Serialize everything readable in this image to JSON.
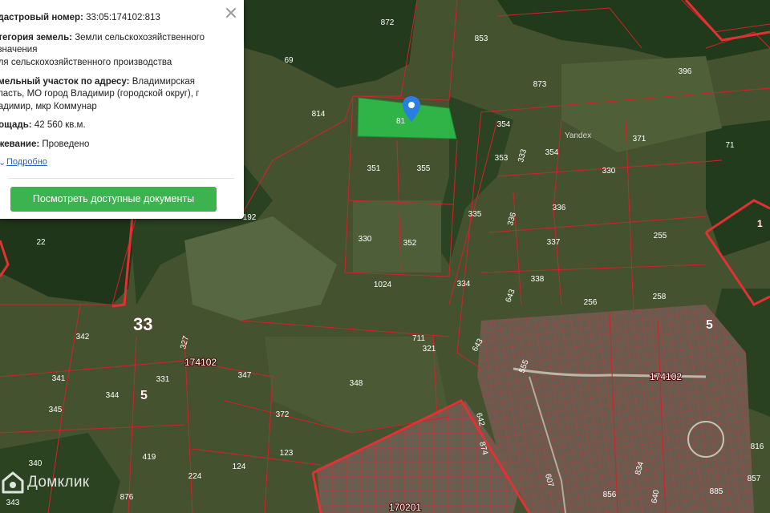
{
  "popup": {
    "cadastral_label": "адастровый номер:",
    "cadastral_value": "33:05:174102:813",
    "category_label": "атегория земель:",
    "category_line1": "Земли сельскохозяйственного",
    "category_line2": "азначения",
    "category_line3": "для сельскохозяйственного производства",
    "address_label": "емельный участок по адресу:",
    "address_line1": "Владимирская",
    "address_line2": "бласть, МО город Владимир (городской округ), г",
    "address_line3": "ладимир, мкр Коммунар",
    "area_label": "лощадь:",
    "area_value": "42 560 кв.м.",
    "survey_label": "ежевание:",
    "survey_value": "Проведено",
    "more_link": "Подробно",
    "docs_button": "Посмотреть доступные документы"
  },
  "map": {
    "provider": "Yandex",
    "selected_plot": "813",
    "selected_plot_visible": "81",
    "block_labels": [
      "174102",
      "174102",
      "170201"
    ],
    "zone_labels": [
      "33",
      "5",
      "5",
      "1"
    ],
    "plot_labels": [
      "872",
      "853",
      "873",
      "396",
      "814",
      "354",
      "371",
      "71",
      "69",
      "353",
      "333",
      "354",
      "330",
      "351",
      "355",
      "192",
      "335",
      "336",
      "255",
      "22",
      "330",
      "352",
      "337",
      "1024",
      "334",
      "336",
      "338",
      "258",
      "256",
      "643",
      "342",
      "327",
      "711",
      "321",
      "643",
      "555",
      "341",
      "331",
      "347",
      "344",
      "348",
      "345",
      "372",
      "642",
      "340",
      "419",
      "123",
      "124",
      "224",
      "876",
      "343",
      "874",
      "834",
      "856",
      "885",
      "816",
      "640",
      "607",
      "857"
    ]
  },
  "logo": {
    "text": "Домклик"
  },
  "colors": {
    "selected_fill": "#2fbf4a",
    "boundary": "#d2222a",
    "button": "#3db34f",
    "link": "#2962c4"
  }
}
